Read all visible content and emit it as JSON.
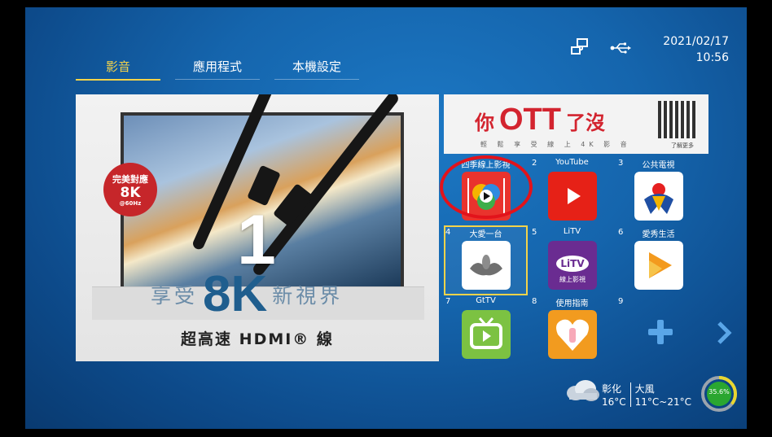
{
  "tabs": [
    {
      "label": "影音",
      "active": true
    },
    {
      "label": "應用程式",
      "active": false
    },
    {
      "label": "本機設定",
      "active": false
    }
  ],
  "status_icons": [
    "network-icon",
    "usb-icon"
  ],
  "clock": {
    "date": "2021/02/17",
    "time": "10:56"
  },
  "banner": {
    "badge": {
      "line1": "完美對應",
      "line2": "8K",
      "line3": "@60Hz"
    },
    "number": "1",
    "slogan": {
      "prefix": "享受",
      "highlight": "8K",
      "suffix": "新視界"
    },
    "hdmi_line": "超高速 HDMI® 線"
  },
  "ott_banner": {
    "text_a": "你",
    "text_b": "OTT",
    "text_c": "了沒",
    "subtitle": "輕 鬆 享 受 線 上 4K 影 音",
    "qr_caption": "了解更多"
  },
  "apps": [
    {
      "num": "",
      "label": "四季線上影視",
      "icon": "4gtv-icon"
    },
    {
      "num": "2",
      "label": "YouTube",
      "icon": "youtube-icon"
    },
    {
      "num": "3",
      "label": "公共電視",
      "icon": "pts-icon"
    },
    {
      "num": "4",
      "label": "大愛一台",
      "icon": "daai-icon"
    },
    {
      "num": "5",
      "label": "LiTV",
      "icon": "litv-icon"
    },
    {
      "num": "6",
      "label": "愛秀生活",
      "icon": "aixiu-icon"
    },
    {
      "num": "7",
      "label": "GtTV",
      "icon": "gttv-icon"
    },
    {
      "num": "8",
      "label": "使用指南",
      "icon": "guide-icon"
    },
    {
      "num": "9",
      "label": "",
      "icon": "add-icon"
    }
  ],
  "litv_text": {
    "brand": "LiTV",
    "sub": "線上影視"
  },
  "weather": {
    "city": "彰化",
    "temp": "16°C",
    "condition": "大風",
    "range": "11°C~21°C",
    "icon": "cloud-icon"
  },
  "gauge": {
    "value_text": "35.6%",
    "value": 35.6
  },
  "colors": {
    "accent": "#f4d34a",
    "background": "#1565ad",
    "annotation": "#e2131b"
  }
}
